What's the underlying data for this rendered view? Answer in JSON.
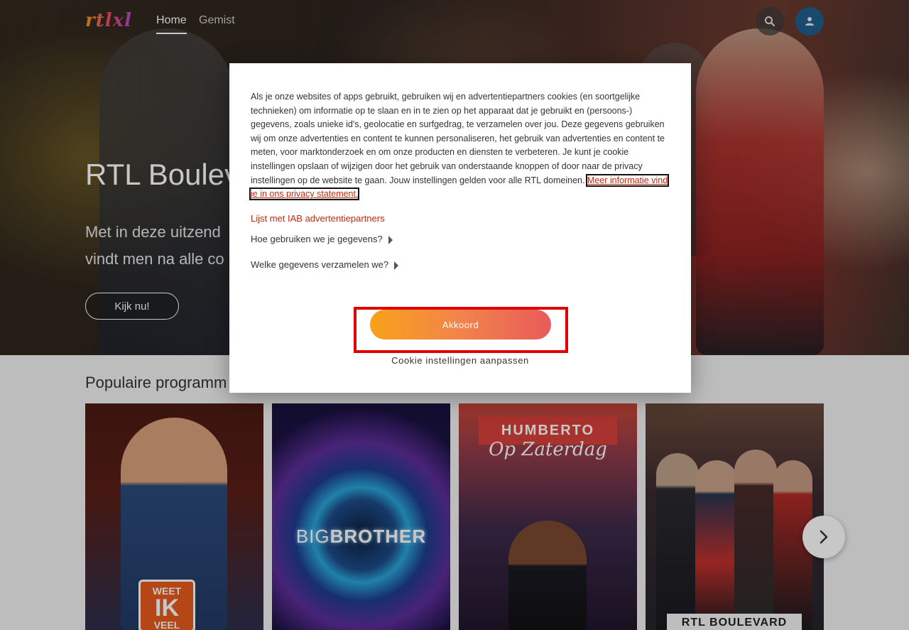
{
  "header": {
    "logo_text": "rtlxl",
    "nav": [
      {
        "label": "Home",
        "active": true
      },
      {
        "label": "Gemist",
        "active": false
      }
    ],
    "icons": {
      "search": "search-icon",
      "account": "user-icon"
    }
  },
  "hero": {
    "title": "RTL Boulev",
    "description_lines": [
      "Met in deze uitzend",
      "vindt men na alle co"
    ],
    "cta_label": "Kijk nu!"
  },
  "section": {
    "title": "Populaire programm"
  },
  "cards": [
    {
      "badge_lines": [
        "WEET",
        "IK",
        "VEEL"
      ]
    },
    {
      "logo_text_1": "BIG",
      "logo_text_2": "BROTHER"
    },
    {
      "title": "HUMBERTO",
      "subtitle": "Op Zaterdag"
    },
    {
      "footer_text": "RTL BOULEVARD"
    }
  ],
  "carousel": {
    "next_icon": "chevron-right-icon"
  },
  "cookie_modal": {
    "body_text": "Als je onze websites of apps gebruikt, gebruiken wij en advertentiepartners cookies (en soortgelijke technieken) om informatie op te slaan en in te zien op het apparaat dat je gebruikt en (persoons-) gegevens, zoals unieke id's, geolocatie en surfgedrag, te verzamelen over jou. Deze gegevens gebruiken wij om onze advertenties en content te kunnen personaliseren, het gebruik van advertenties en content te meten, voor marktonderzoek en om onze producten en diensten te verbeteren. Je kunt je cookie instellingen opslaan of wijzigen door het gebruik van onderstaande knoppen of door naar de privacy instellingen op de website te gaan. Jouw instellingen gelden voor alle RTL domeinen.",
    "privacy_link": "Meer informatie vind je in ons privacy statement.",
    "iab_link": "Lijst met IAB advertentiepartners",
    "expanders": [
      "Hoe gebruiken we je gegevens?",
      "Welke gegevens verzamelen we?"
    ],
    "accept_label": "Akkoord",
    "settings_label": "Cookie instellingen aanpassen",
    "colors": {
      "accent_link": "#c1290f",
      "highlight_frame": "#e00000",
      "button_start": "#f7a21b",
      "button_end": "#e95b5b"
    }
  }
}
